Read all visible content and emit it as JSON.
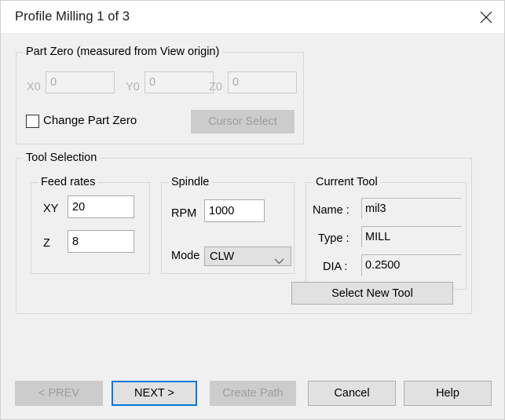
{
  "window": {
    "title": "Profile Milling 1 of 3",
    "close_icon": "close-icon"
  },
  "part_zero": {
    "title": "Part Zero (measured from View origin)",
    "fields": [
      {
        "label": "X0",
        "value": "0",
        "disabled": true
      },
      {
        "label": "Y0",
        "value": "0",
        "disabled": true
      },
      {
        "label": "Z0",
        "value": "0",
        "disabled": true
      }
    ],
    "checkbox": {
      "label": "Change Part Zero",
      "checked": false
    },
    "cursor_select_label": "Cursor Select"
  },
  "tool_selection": {
    "title": "Tool Selection",
    "feed_rates": {
      "title": "Feed rates",
      "xy_label": "XY",
      "xy_value": "20",
      "z_label": "Z",
      "z_value": "8"
    },
    "spindle": {
      "title": "Spindle",
      "rpm_label": "RPM",
      "rpm_value": "1000",
      "mode_label": "Mode",
      "mode_value": "CLW",
      "mode_options": [
        "CLW"
      ],
      "dropdown_icon": "chevron-down-icon"
    },
    "current_tool": {
      "title": "Current Tool",
      "name_label": "Name :",
      "name_value": "mil3",
      "type_label": "Type :",
      "type_value": "MILL",
      "dia_label": "DIA :",
      "dia_value": "0.2500"
    },
    "select_new_tool_label": "Select New Tool"
  },
  "footer": {
    "prev_label": "< PREV",
    "next_label": "NEXT >",
    "create_path_label": "Create Path",
    "cancel_label": "Cancel",
    "help_label": "Help"
  },
  "colors": {
    "dialog_background": "#f0f0f0",
    "titlebar_background": "#ffffff",
    "accent_focus": "#0078d7",
    "disabled_text": "#9d9d9d",
    "disabled_button": "#cccccc",
    "input_border": "#aaaaaa",
    "group_border": "#d8d8d8"
  }
}
